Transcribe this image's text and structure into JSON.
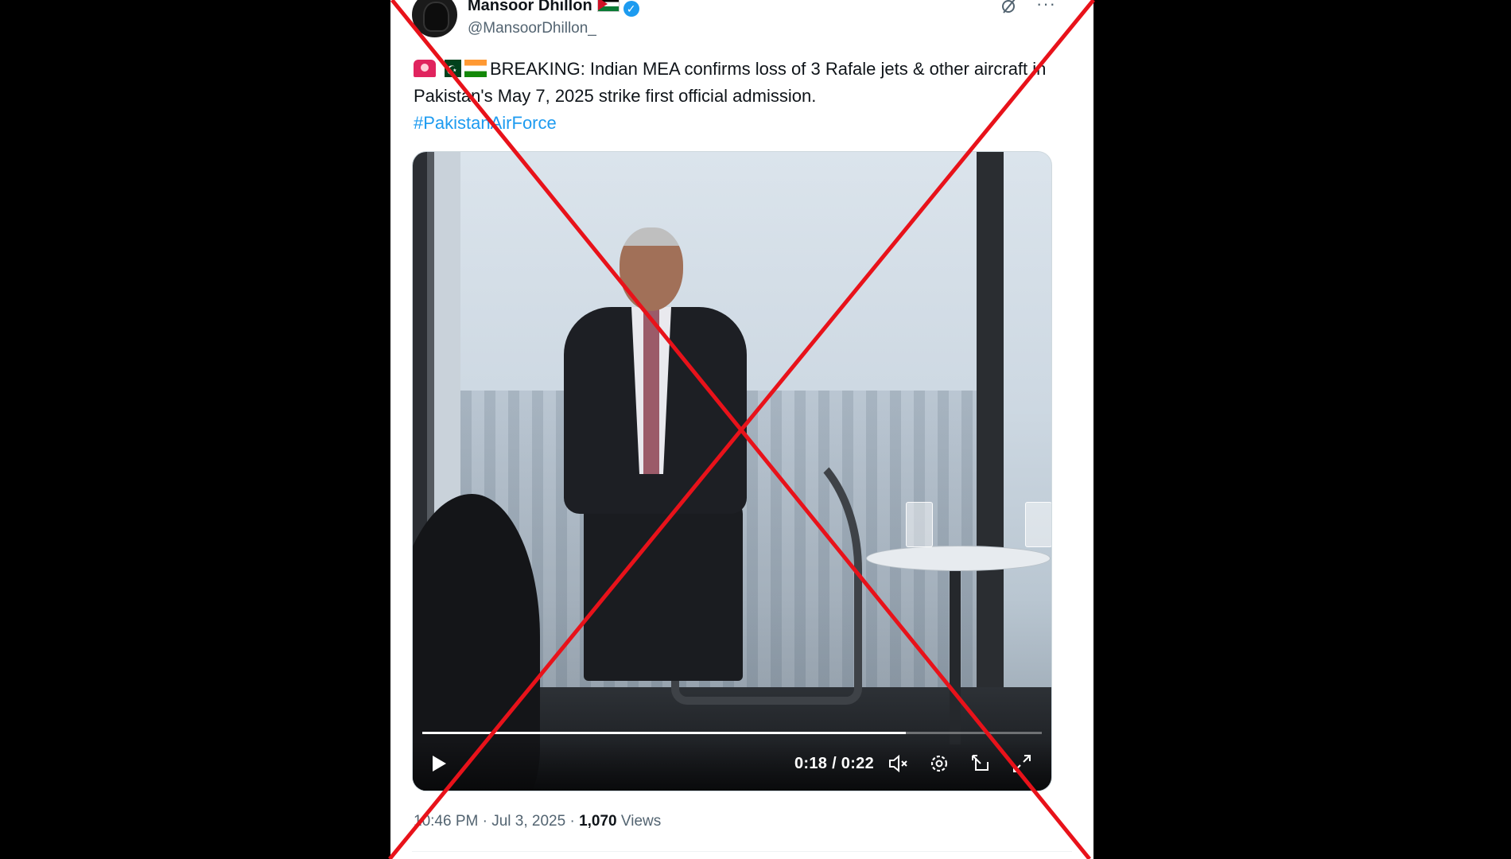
{
  "author": {
    "display_name": "Mansoor Dhillon",
    "handle": "@MansoorDhillon_",
    "flag_icon": "jordan-flag-emoji",
    "verified_icon": "verified-badge-icon",
    "avatar_icon": "hooded-figure-avatar"
  },
  "header_actions": {
    "grok_icon": "grok-icon",
    "more_icon": "more-options-icon",
    "more_label": "···"
  },
  "tweet": {
    "emojis": [
      "siren-emoji",
      "pakistan-flag-emoji",
      "india-flag-emoji"
    ],
    "text": "BREAKING: Indian MEA confirms loss of 3 Rafale jets & other aircraft in Pakistan's May 7, 2025 strike first official admission.",
    "hashtag": "#PakistanAirForce"
  },
  "video": {
    "time_label": "0:18 / 0:22",
    "progress_fraction": 0.78,
    "icons": [
      "play-icon",
      "mute-icon",
      "settings-icon",
      "picture-in-picture-icon",
      "fullscreen-icon"
    ]
  },
  "meta": {
    "time": "10:46 PM",
    "separator": "·",
    "date": "Jul 3, 2025",
    "views_count": "1,070",
    "views_label": "Views"
  },
  "colors": {
    "accent": "#1d9bf0",
    "cross_overlay": "#e8121a",
    "text_primary": "#0f1419",
    "text_secondary": "#536471"
  }
}
